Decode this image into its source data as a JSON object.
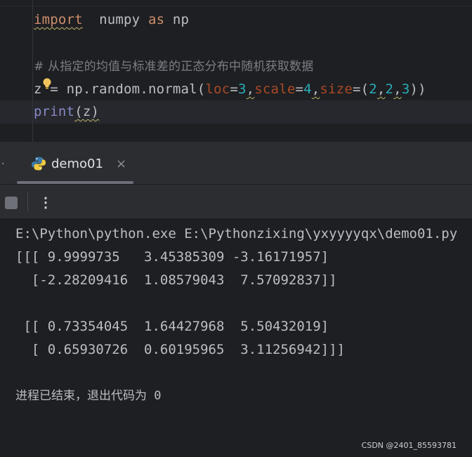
{
  "editor": {
    "line1": {
      "kw_import": "import",
      "module": "numpy",
      "kw_as": "as",
      "alias": "np"
    },
    "comment": "# 从指定的均值与标准差的正态分布中随机获取数据",
    "line3": {
      "var": "z",
      "op": "=",
      "call": "np.random.normal(",
      "p1": "loc",
      "v1": "3",
      "p2": "scale",
      "v2": "4",
      "p3": "size",
      "v3_open": "=(",
      "v3a": "2",
      "v3b": "2",
      "v3c": "3",
      "close": "))"
    },
    "line4": {
      "fn": "print",
      "arg": "(z)"
    }
  },
  "run_panel": {
    "tab_label": "demo01",
    "tab_close": "×",
    "more_icon": "⋮"
  },
  "console": {
    "lines": [
      "E:\\Python\\python.exe E:\\Pythonzixing\\yxyyyyqx\\demo01.py",
      "[[[ 9.9999735   3.45385309 -3.16171957]",
      "  [-2.28209416  1.08579043  7.57092837]]",
      "",
      " [[ 0.73354045  1.64427968  5.50432019]",
      "  [ 0.65930726  0.60195965  3.11256942]]]",
      "",
      "进程已结束，退出代码为 0"
    ]
  },
  "watermark": "CSDN @2401_85593781",
  "colors": {
    "background": "#1e1f22",
    "keyword": "#cf8e6d",
    "param": "#aa4926",
    "number": "#2aacb8",
    "builtin": "#8888c6",
    "comment": "#7a7e85"
  },
  "icons": [
    "lightbulb-icon",
    "python-icon",
    "close-icon",
    "stop-icon",
    "more-vertical-icon"
  ]
}
